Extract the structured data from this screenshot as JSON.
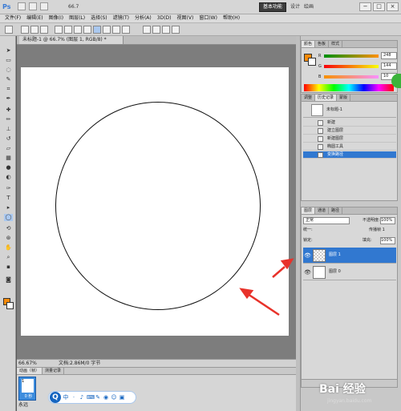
{
  "app": {
    "logo": "Ps",
    "zoom_display": "66.7"
  },
  "menu": [
    "文件(F)",
    "编辑(E)",
    "图像(I)",
    "图层(L)",
    "选择(S)",
    "滤镜(T)",
    "分析(A)",
    "3D(D)",
    "视图(V)",
    "窗口(W)",
    "帮助(H)"
  ],
  "workspace": {
    "active": "基本功能",
    "design": "设计",
    "draw": "绘画"
  },
  "window_controls": {
    "min": "−",
    "max": "□",
    "close": "×"
  },
  "document": {
    "tab_title": "未标题-1 @ 66.7% (图层 1, RGB/8) *",
    "status_zoom": "66.67%",
    "status_doc": "文档:2.86M/0 字节"
  },
  "bottom_panel": {
    "tabs": [
      "动画（帧）",
      "测量记录"
    ],
    "frame_number": "1",
    "frame_time": "0 秒",
    "loop": "永远"
  },
  "ime": {
    "logo": "Q",
    "items": [
      "中",
      "·",
      "♪",
      "⌨",
      "✎",
      "◉",
      "☺",
      "▣"
    ]
  },
  "color_panel": {
    "tabs": [
      "颜色",
      "色板",
      "样式"
    ],
    "r_label": "R",
    "r_value": "248",
    "g_label": "G",
    "g_value": "144",
    "b_label": "B",
    "b_value": "10",
    "fg_color": "#f78a0a"
  },
  "history_panel": {
    "tabs": [
      "调整",
      "历史记录",
      "蒙版"
    ],
    "snapshot": "未标题-1",
    "items": [
      "新建",
      "建立图层",
      "新建图层",
      "椭圆工具",
      "变换路径"
    ]
  },
  "layers_panel": {
    "tabs": [
      "图层",
      "通道",
      "路径"
    ],
    "blend_mode": "正常",
    "opacity_label": "不透明度:",
    "opacity": "100%",
    "unify_label": "统一:",
    "propagate": "传播帧 1",
    "lock_label": "锁定:",
    "fill_label": "填充:",
    "fill": "100%",
    "layers": [
      {
        "name": "图层 1",
        "selected": true
      },
      {
        "name": "图层 0",
        "selected": false
      }
    ]
  },
  "watermark": {
    "main": "Bai 经验",
    "sub": "jingyan.baidu.com"
  }
}
